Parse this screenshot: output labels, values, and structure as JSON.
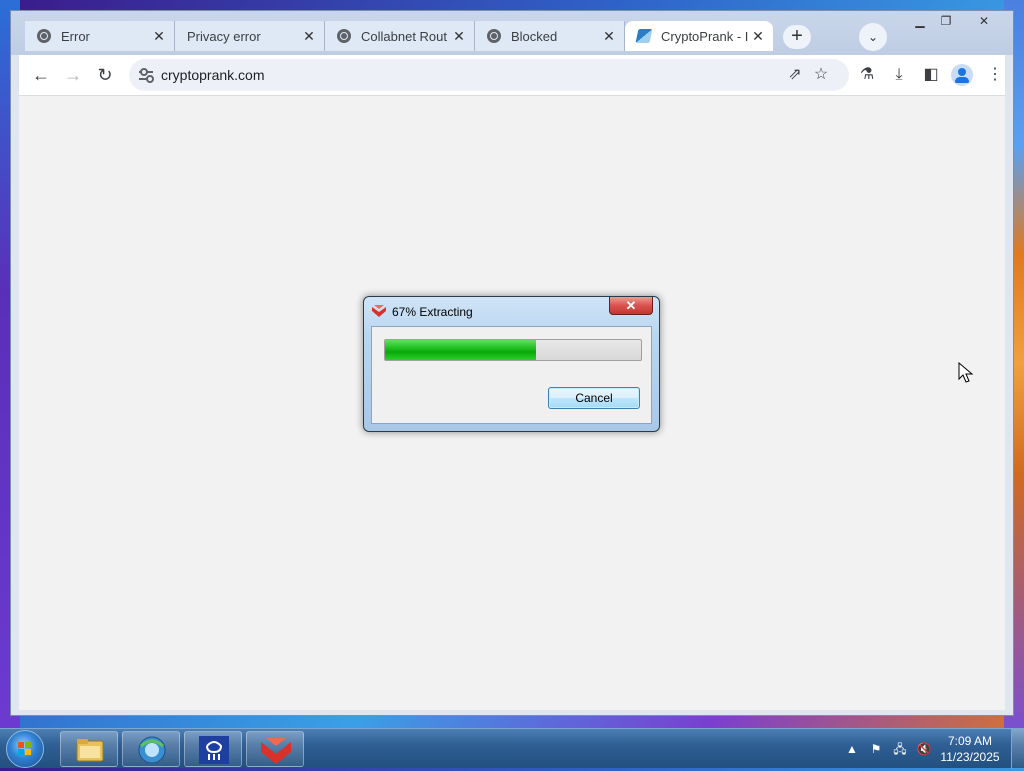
{
  "browser": {
    "tabs": [
      {
        "title": "Error",
        "active": false
      },
      {
        "title": "Privacy error",
        "active": false
      },
      {
        "title": "Collabnet Rout",
        "active": false
      },
      {
        "title": "Blocked",
        "active": false
      },
      {
        "title": "CryptoPrank - I",
        "active": true
      }
    ],
    "url": "cryptoprank.com"
  },
  "dialog": {
    "title": "67% Extracting",
    "progress_percent": 67,
    "progress_fill_fraction": 0.59,
    "cancel_label": "Cancel"
  },
  "taskbar": {
    "time": "7:09 AM",
    "date": "11/23/2025"
  },
  "icons": {
    "back": "arrow-left-icon",
    "forward": "arrow-right-icon",
    "reload": "reload-icon",
    "share": "share-icon",
    "star": "star-icon",
    "labs": "flask-icon",
    "download": "download-icon",
    "sidepanel": "side-panel-icon",
    "menu": "kebab-menu-icon"
  },
  "colors": {
    "progress_green": "#0aa80a",
    "close_red": "#c2362e",
    "profile_blue": "#1a73e8"
  }
}
